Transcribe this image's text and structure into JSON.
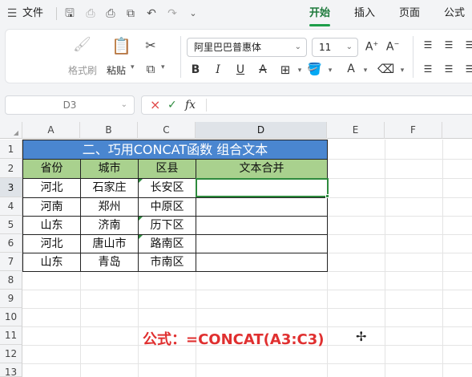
{
  "menubar": {
    "file_label": "文件",
    "tabs": [
      "开始",
      "插入",
      "页面",
      "公式"
    ],
    "active_tab": "开始"
  },
  "ribbon": {
    "format_painter_label": "格式刷",
    "paste_label": "粘贴",
    "font_name": "阿里巴巴普惠体",
    "font_size": "11"
  },
  "formula_bar": {
    "name_box": "D3",
    "cancel_icon": "×",
    "confirm_icon": "✓",
    "fx_label": "fx",
    "content": ""
  },
  "sheet": {
    "columns": [
      "A",
      "B",
      "C",
      "D",
      "E",
      "F"
    ],
    "selected_column": "D",
    "rows": [
      "1",
      "2",
      "3",
      "4",
      "5",
      "6",
      "7",
      "8",
      "9",
      "10",
      "11",
      "12",
      "13"
    ],
    "selected_row": "3",
    "title": "二、巧用CONCAT函数 组合文本",
    "headers": [
      "省份",
      "城市",
      "区县",
      "文本合并"
    ],
    "data": [
      [
        "河北",
        "石家庄",
        "长安区",
        ""
      ],
      [
        "河南",
        "郑州",
        "中原区",
        ""
      ],
      [
        "山东",
        "济南",
        "历下区",
        ""
      ],
      [
        "河北",
        "唐山市",
        "路南区",
        ""
      ],
      [
        "山东",
        "青岛",
        "市南区",
        ""
      ]
    ],
    "formula_note": "公式：=CONCAT(A3:C3)"
  },
  "colors": {
    "title_fill": "#4a86d0",
    "header_fill": "#a9d18e",
    "accent_green": "#1e9e4a",
    "note_red": "#e03030"
  }
}
